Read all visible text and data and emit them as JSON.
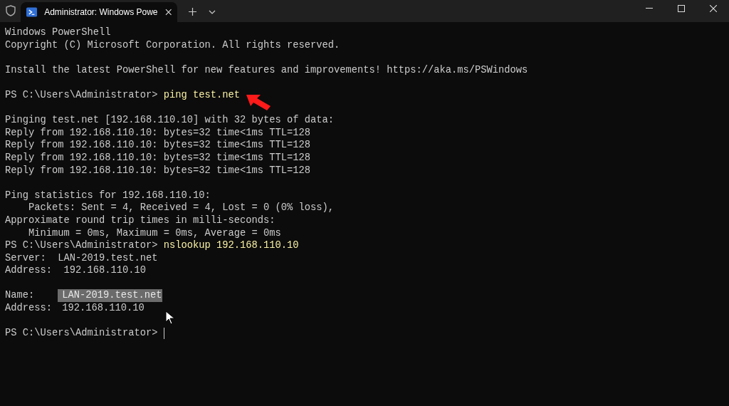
{
  "window": {
    "tab_title": "Administrator: Windows Powe",
    "tab_selected": true
  },
  "terminal": {
    "lines": [
      {
        "kind": "text",
        "text": "Windows PowerShell"
      },
      {
        "kind": "text",
        "text": "Copyright (C) Microsoft Corporation. All rights reserved."
      },
      {
        "kind": "blank"
      },
      {
        "kind": "text",
        "text": "Install the latest PowerShell for new features and improvements! https://aka.ms/PSWindows"
      },
      {
        "kind": "blank"
      },
      {
        "kind": "prompt",
        "prompt": "PS C:\\Users\\Administrator>",
        "command": "ping test.net"
      },
      {
        "kind": "blank"
      },
      {
        "kind": "text",
        "text": "Pinging test.net [192.168.110.10] with 32 bytes of data:"
      },
      {
        "kind": "text",
        "text": "Reply from 192.168.110.10: bytes=32 time<1ms TTL=128"
      },
      {
        "kind": "text",
        "text": "Reply from 192.168.110.10: bytes=32 time<1ms TTL=128"
      },
      {
        "kind": "text",
        "text": "Reply from 192.168.110.10: bytes=32 time<1ms TTL=128"
      },
      {
        "kind": "text",
        "text": "Reply from 192.168.110.10: bytes=32 time<1ms TTL=128"
      },
      {
        "kind": "blank"
      },
      {
        "kind": "text",
        "text": "Ping statistics for 192.168.110.10:"
      },
      {
        "kind": "text",
        "text": "    Packets: Sent = 4, Received = 4, Lost = 0 (0% loss),"
      },
      {
        "kind": "text",
        "text": "Approximate round trip times in milli-seconds:"
      },
      {
        "kind": "text",
        "text": "    Minimum = 0ms, Maximum = 0ms, Average = 0ms"
      },
      {
        "kind": "prompt",
        "prompt": "PS C:\\Users\\Administrator>",
        "command": "nslookup 192.168.110.10"
      },
      {
        "kind": "text",
        "text": "Server:  LAN-2019.test.net"
      },
      {
        "kind": "text",
        "text": "Address:  192.168.110.10"
      },
      {
        "kind": "blank"
      },
      {
        "kind": "field",
        "label": "Name:",
        "value": "LAN-2019.test.net",
        "selected": true
      },
      {
        "kind": "field",
        "label": "Address:",
        "value": "192.168.110.10",
        "selected": false
      },
      {
        "kind": "blank"
      },
      {
        "kind": "prompt",
        "prompt": "PS C:\\Users\\Administrator>",
        "cursor": true
      }
    ]
  }
}
